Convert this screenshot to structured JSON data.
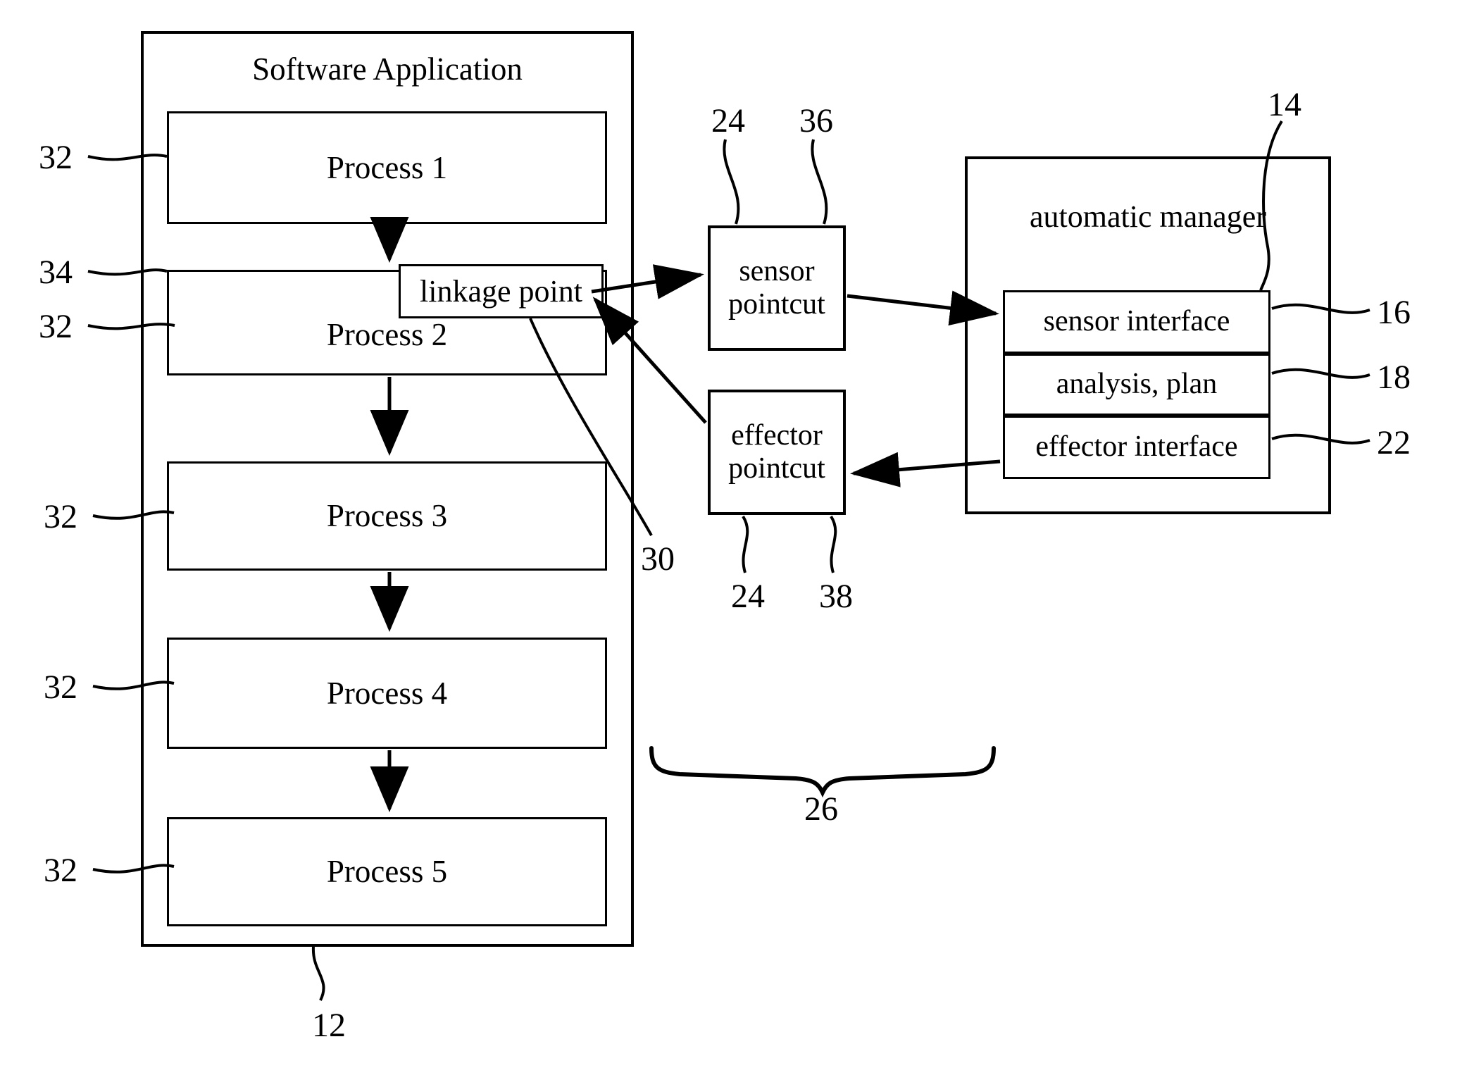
{
  "figure": {
    "software_application": {
      "title": "Software Application",
      "processes": [
        {
          "label": "Process 1"
        },
        {
          "label": "Process 2"
        },
        {
          "label": "Process 3"
        },
        {
          "label": "Process 4"
        },
        {
          "label": "Process 5"
        }
      ],
      "linkage_point": {
        "label": "linkage point"
      }
    },
    "pointcuts": [
      {
        "label": "sensor\npointcut"
      },
      {
        "label": "effector\npointcut"
      }
    ],
    "automatic_manager": {
      "title": "automatic manager",
      "interfaces": [
        {
          "label": "sensor interface"
        },
        {
          "label": "analysis, plan"
        },
        {
          "label": "effector interface"
        }
      ]
    },
    "reference_numerals": {
      "app_32_p1": "32",
      "app_34": "34",
      "app_32_p2": "32",
      "app_32_p3": "32",
      "app_32_p4": "32",
      "app_32_p5": "32",
      "app_12": "12",
      "linkage_30": "30",
      "sensor_24": "24",
      "sensor_36": "36",
      "effector_24": "24",
      "effector_38": "38",
      "brace_26": "26",
      "manager_14": "14",
      "sensor_iface_16": "16",
      "analysis_18": "18",
      "effector_iface_22": "22"
    },
    "colors": {
      "stroke": "#000000",
      "background": "#ffffff"
    }
  }
}
